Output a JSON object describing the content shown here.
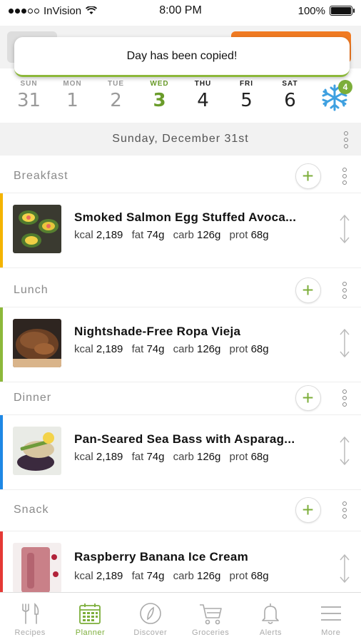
{
  "status_bar": {
    "carrier": "InVision",
    "time": "8:00 PM",
    "battery": "100%"
  },
  "toast": {
    "message": "Day has been copied!"
  },
  "week": {
    "days": [
      {
        "name": "SUN",
        "number": "31",
        "state": "past"
      },
      {
        "name": "MON",
        "number": "1",
        "state": "past"
      },
      {
        "name": "TUE",
        "number": "2",
        "state": "past"
      },
      {
        "name": "WED",
        "number": "3",
        "state": "today"
      },
      {
        "name": "THU",
        "number": "4",
        "state": "future"
      },
      {
        "name": "FRI",
        "number": "5",
        "state": "future"
      },
      {
        "name": "SAT",
        "number": "6",
        "state": "future"
      }
    ],
    "freezer_badge": "4"
  },
  "date_header": "Sunday, December 31st",
  "meals": [
    {
      "section": "Breakfast",
      "color": "#f4b400",
      "title": "Smoked Salmon Egg Stuffed Avoca...",
      "kcal": "2,189",
      "fat": "74g",
      "carb": "126g",
      "prot": "68g"
    },
    {
      "section": "Lunch",
      "color": "#8cb83a",
      "title": "Nightshade-Free Ropa Vieja",
      "kcal": "2,189",
      "fat": "74g",
      "carb": "126g",
      "prot": "68g"
    },
    {
      "section": "Dinner",
      "color": "#1e88e5",
      "title": "Pan-Seared Sea Bass with Asparag...",
      "kcal": "2,189",
      "fat": "74g",
      "carb": "126g",
      "prot": "68g"
    },
    {
      "section": "Snack",
      "color": "#e53935",
      "title": "Raspberry Banana Ice Cream",
      "kcal": "2,189",
      "fat": "74g",
      "carb": "126g",
      "prot": "68g"
    }
  ],
  "macro_labels": {
    "kcal": "kcal",
    "fat": "fat",
    "carb": "carb",
    "prot": "prot"
  },
  "tabs": [
    {
      "label": "Recipes",
      "icon": "fork-knife-icon",
      "active": false
    },
    {
      "label": "Planner",
      "icon": "calendar-icon",
      "active": true
    },
    {
      "label": "Discover",
      "icon": "compass-icon",
      "active": false
    },
    {
      "label": "Groceries",
      "icon": "cart-icon",
      "active": false
    },
    {
      "label": "Alerts",
      "icon": "bell-icon",
      "active": false
    },
    {
      "label": "More",
      "icon": "menu-icon",
      "active": false
    }
  ],
  "colors": {
    "accent_green": "#7cae3a",
    "orange": "#f07a22"
  }
}
